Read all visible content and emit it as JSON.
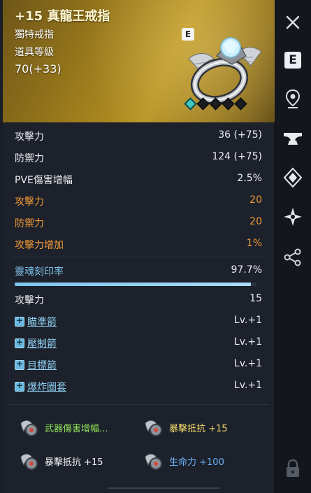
{
  "item": {
    "name": "+15 真龍王戒指",
    "type": "獨特戒指",
    "level_label": "道具等級",
    "level": "70(+33)",
    "grade_badge": "E",
    "upgrade_stars": {
      "total": 5,
      "filled": 1
    }
  },
  "stats": [
    {
      "label": "攻擊力",
      "value": "36 (+75)",
      "color": "white"
    },
    {
      "label": "防禦力",
      "value": "124 (+75)",
      "color": "white"
    },
    {
      "label": "PVE傷害增幅",
      "value": "2.5%",
      "color": "white"
    },
    {
      "label": "攻擊力",
      "value": "20",
      "color": "orange"
    },
    {
      "label": "防禦力",
      "value": "20",
      "color": "orange"
    },
    {
      "label": "攻擊力增加",
      "value": "1%",
      "color": "orange"
    }
  ],
  "soul": {
    "label": "靈魂刻印率",
    "value": "97.7%",
    "progress_percent": 97.7
  },
  "soul_bonus": {
    "label": "攻擊力",
    "value": "15"
  },
  "skills": [
    {
      "name": "瞄準箭",
      "level": "Lv.+1"
    },
    {
      "name": "壓制箭",
      "level": "Lv.+1"
    },
    {
      "name": "目標箭",
      "level": "Lv.+1"
    },
    {
      "name": "爆炸圈套",
      "level": "Lv.+1"
    }
  ],
  "bonus_options": [
    {
      "text": "武器傷害增幅...",
      "color": "#8fe05a"
    },
    {
      "text": "暴擊抵抗 +15",
      "color": "#f3d96b"
    },
    {
      "text": "暴擊抵抗 +15",
      "color": "#f2f2f2"
    },
    {
      "text": "生命力 +100",
      "color": "#6fb6ff"
    }
  ],
  "sidebar": {
    "close": "close-icon",
    "equip": "E",
    "buttons": [
      "location-pin-icon",
      "anvil-icon",
      "diamond-gem-icon",
      "sparkle-star-icon",
      "share-icon",
      "lock-icon"
    ]
  }
}
